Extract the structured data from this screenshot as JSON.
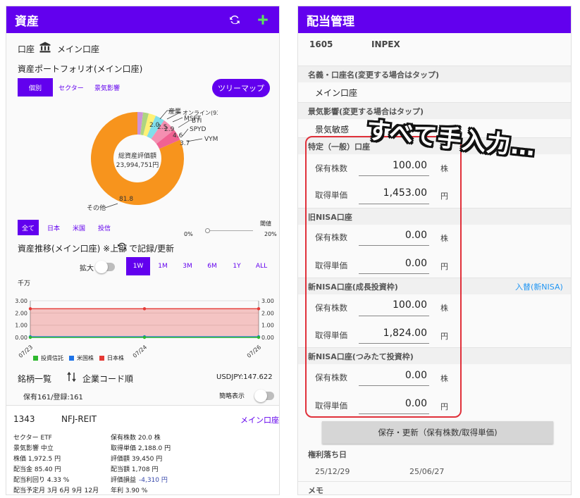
{
  "left": {
    "appbar": {
      "title": "資産"
    },
    "account_label": "口座",
    "account_name": "メイン口座",
    "portfolio_title": "資産ポートフォリオ(メイン口座)",
    "portfolio_tabs": [
      "個別",
      "セクター",
      "景気影響"
    ],
    "treemap_button": "ツリーマップ",
    "donut": {
      "center_label": "総資産評価額",
      "center_value": "23,994,751円",
      "labels": [
        "産業",
        "オンライン(9349)",
        "MSFT",
        "BTI",
        "SPYD",
        "VYM",
        "その他"
      ],
      "values": [
        "2.0",
        "2.5",
        "2.9",
        "4.6",
        "3.7",
        "81.8"
      ]
    },
    "filter_tabs": [
      "全て",
      "日本",
      "米国",
      "投信"
    ],
    "threshold_label": "閾値",
    "slider_min": "0%",
    "slider_max": "20%",
    "trend_title": "資産推移(メイン口座) ※上部",
    "trend_title_suffix": "で記録/更新",
    "zoom_label": "拡大",
    "ranges": [
      "1W",
      "1M",
      "3M",
      "6M",
      "1Y",
      "ALL"
    ],
    "unit": "千万",
    "legend": [
      "投資信託",
      "米国株",
      "日本株"
    ],
    "list_title": "銘柄一覧",
    "sort_label": "企業コード順",
    "fx_rate": "USDJPY:147.622",
    "holding_count": "保有161/登録:161",
    "compact_label": "簡略表示",
    "stock": {
      "code": "1343",
      "name": "NFJ-REIT",
      "account": "メイン口座",
      "left_col": [
        "セクター ETF",
        "景気影響 中立",
        "株価 1,972.5 円",
        "配当金 85.40 円",
        "配当利回り 4.33 %",
        "配当予定月 3月 6月 9月 12月"
      ],
      "right_col": [
        "保有株数 20.0 株",
        "取得単価 2,188.0 円",
        "評価額 39,450 円",
        "配当額 1,708 円",
        "評価損益",
        "年利 3.90 %"
      ],
      "pl_value": "-4,310 円"
    }
  },
  "chart_data": {
    "type": "line",
    "x": [
      "07/23",
      "07/24",
      "07/26"
    ],
    "series": [
      {
        "name": "投資信託",
        "values": [
          0.0,
          0.0,
          0.0
        ],
        "color": "#2eb82e"
      },
      {
        "name": "米国株",
        "values": [
          0.05,
          0.05,
          0.05
        ],
        "color": "#1e73e8"
      },
      {
        "name": "日本株",
        "values": [
          2.35,
          2.35,
          2.35
        ],
        "color": "#e53935"
      }
    ],
    "yticks": [
      "0.00",
      "1.00",
      "2.00",
      "3.00"
    ],
    "ylim": [
      0,
      3
    ],
    "ylabel": "千万"
  },
  "right": {
    "appbar": {
      "title": "配当管理"
    },
    "code": "1605",
    "name": "INPEX",
    "account_section": "名義・口座名(変更する場合はタップ)",
    "account_value": "メイン口座",
    "impact_section": "景気影響(変更する場合はタップ)",
    "impact_value": "景気敏感",
    "sections": [
      {
        "title": "特定（一般）口座",
        "shares": "100.00",
        "cost": "1,453.00"
      },
      {
        "title": "旧NISA口座",
        "shares": "0.00",
        "cost": "0.00"
      },
      {
        "title": "新NISA口座(成長投資枠)",
        "shares": "100.00",
        "cost": "1,824.00"
      },
      {
        "title": "新NISA口座(つみたて投資枠)",
        "shares": "0.00",
        "cost": "0.00"
      }
    ],
    "shares_label": "保有株数",
    "cost_label": "取得単価",
    "shares_unit": "株",
    "cost_unit": "円",
    "transfer_link": "入替(新NISA)",
    "save_button": "保存・更新（保有株数/取得単価)",
    "ex_div_section": "権利落ち日",
    "ex_dates": [
      "25/12/29",
      "25/06/27"
    ],
    "memo_section": "メモ",
    "callout": "すべて手入力…"
  }
}
